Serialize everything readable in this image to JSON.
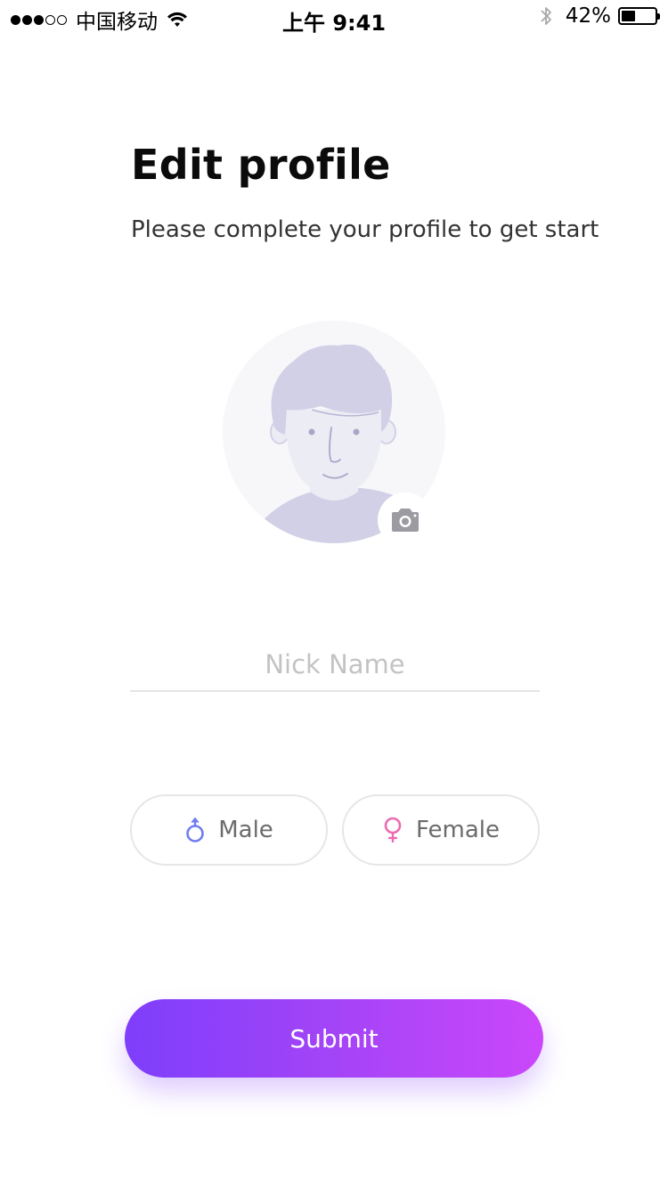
{
  "status_bar": {
    "carrier": "中国移动",
    "time": "上午 9:41",
    "battery_percent": "42%",
    "battery_level": 0.42,
    "signal_bars_filled": 3,
    "signal_bars_total": 5
  },
  "header": {
    "title": "Edit profile",
    "subtitle": "Please complete your profile to get start"
  },
  "avatar": {
    "icon": "user-placeholder-icon",
    "camera_icon": "camera-icon"
  },
  "form": {
    "nickname": {
      "value": "",
      "placeholder": "Nick Name"
    },
    "gender": {
      "options": [
        {
          "label": "Male",
          "icon": "male-symbol-icon",
          "color": "#6f7df0"
        },
        {
          "label": "Female",
          "icon": "female-symbol-icon",
          "color": "#ec6bb3"
        }
      ]
    }
  },
  "submit": {
    "label": "Submit"
  },
  "colors": {
    "accent_start": "#7e3efb",
    "accent_end": "#cb47fb",
    "avatar_fill": "#d2d0e6"
  }
}
